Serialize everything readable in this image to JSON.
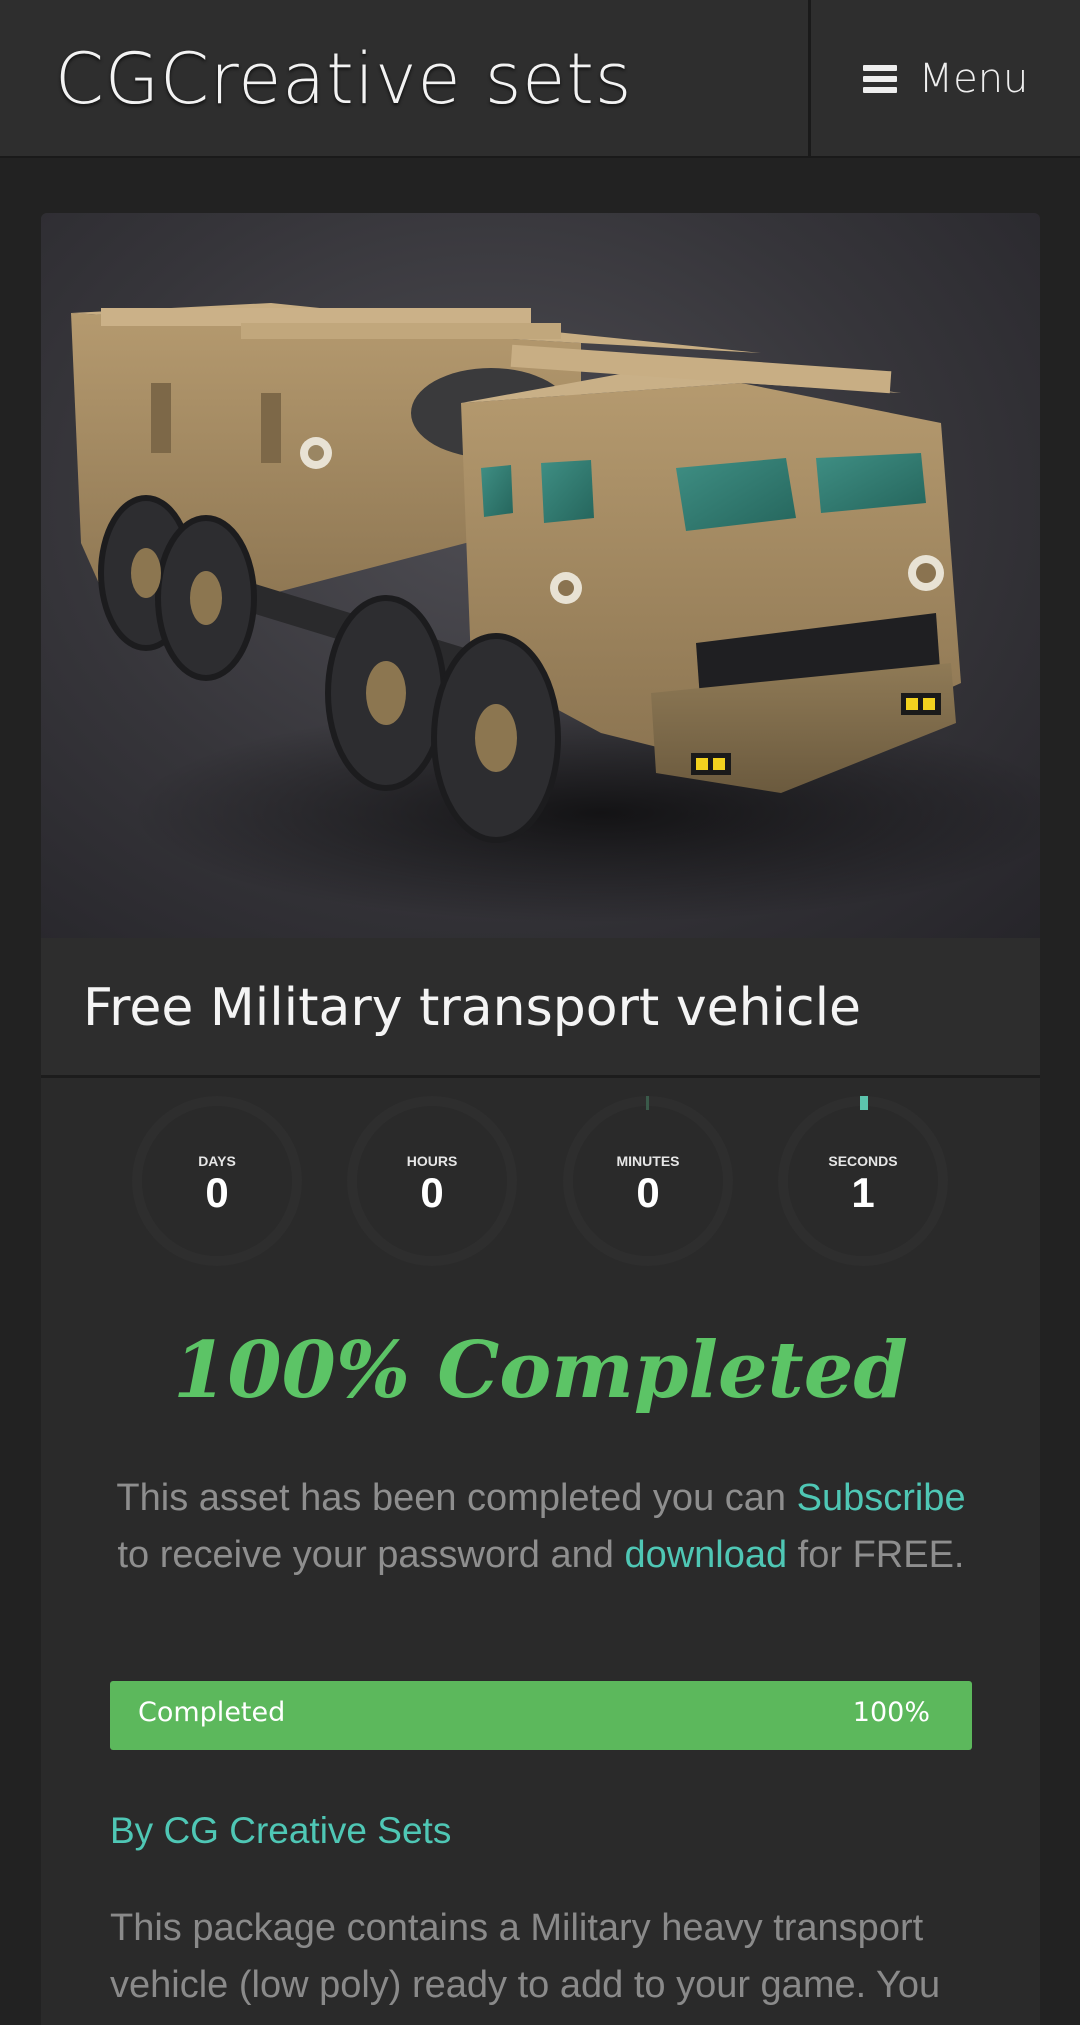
{
  "header": {
    "site_title": "CGCreative sets",
    "menu_label": "Menu"
  },
  "card": {
    "image_alt": "Military transport vehicle",
    "title": "Free Military transport vehicle"
  },
  "countdown": [
    {
      "label": "DAYS",
      "value": "0"
    },
    {
      "label": "HOURS",
      "value": "0"
    },
    {
      "label": "MINUTES",
      "value": "0"
    },
    {
      "label": "SECONDS",
      "value": "1"
    }
  ],
  "status": {
    "heading": "100% Completed",
    "desc_pre": "This asset has been completed you can ",
    "subscribe_link": "Subscribe",
    "desc_mid": " to receive your password and ",
    "download_link": "download",
    "desc_post": " for FREE."
  },
  "progress": {
    "label": "Completed",
    "value_text": "100%",
    "fraction": 1.0
  },
  "author": {
    "byline": "By CG Creative Sets"
  },
  "body": {
    "text": "This package contains a Military heavy transport vehicle (low poly)  ready to add to your game. You"
  },
  "colors": {
    "accent": "#4fc7b5",
    "success": "#5cb85c",
    "heading_green": "#5cc466",
    "background": "#222222"
  }
}
